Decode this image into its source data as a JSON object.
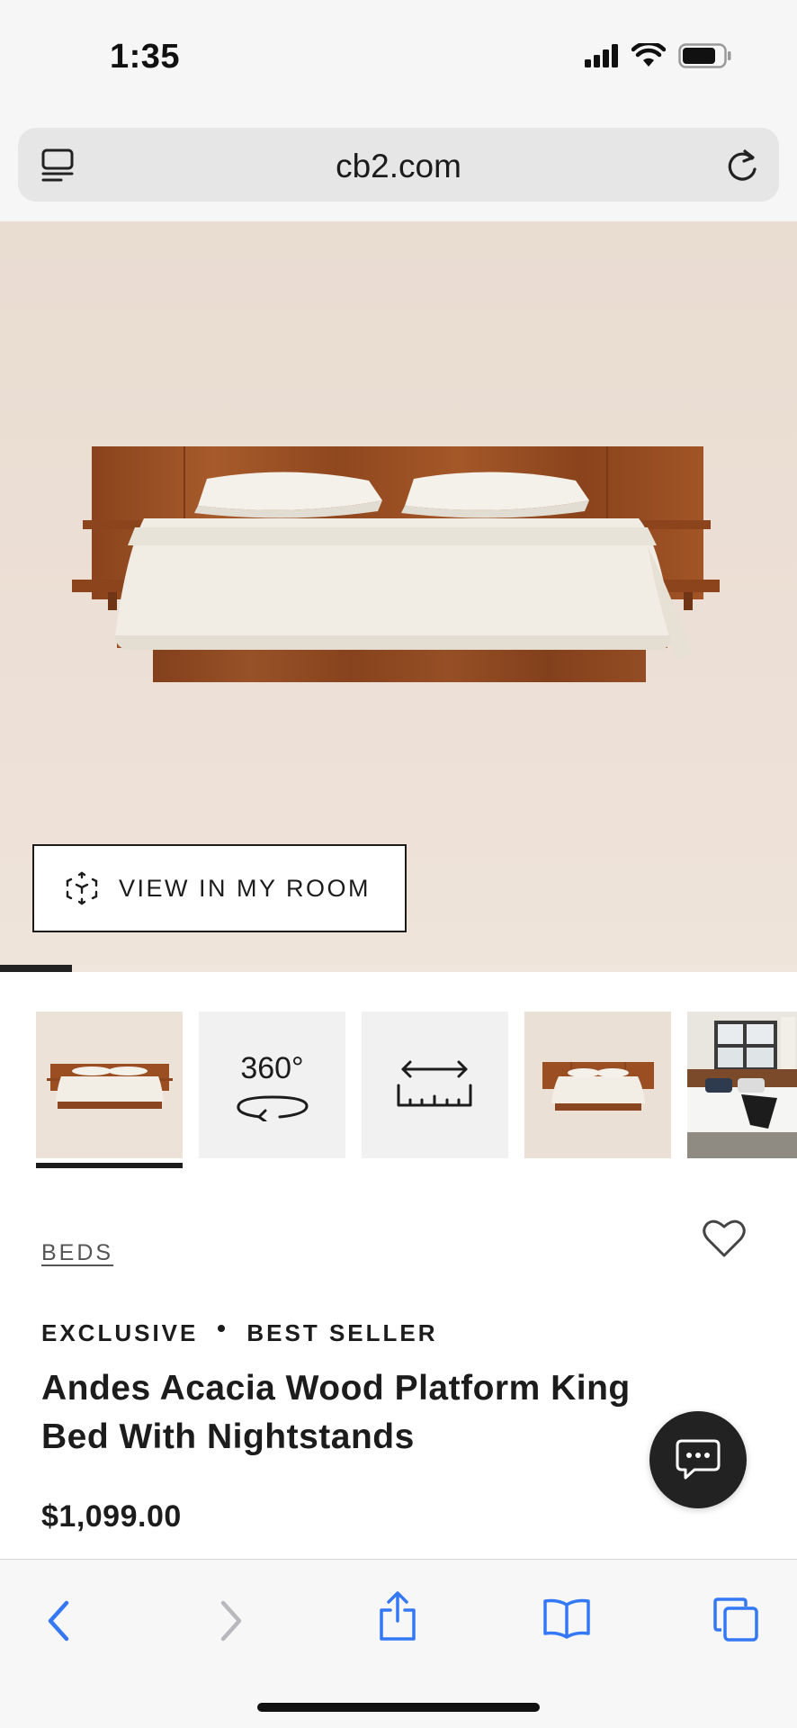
{
  "status_bar": {
    "time": "1:35",
    "icons": [
      "cellular-signal-icon",
      "wifi-icon",
      "battery-icon"
    ]
  },
  "browser": {
    "url": "cb2.com",
    "left_icon": "reader-mode-icon",
    "right_icon": "reload-icon"
  },
  "hero": {
    "image": "acacia-wood-platform-bed-photo",
    "view_in_room_label": "VIEW IN MY ROOM",
    "view_in_room_icon": "ar-cube-icon",
    "gallery_progress": 0.09
  },
  "thumbnails": [
    {
      "type": "image",
      "description": "bed-front"
    },
    {
      "type": "360",
      "label": "360°"
    },
    {
      "type": "dimensions",
      "icon": "ruler-icon"
    },
    {
      "type": "image",
      "description": "bed-front-2"
    },
    {
      "type": "image",
      "description": "bedroom-scene"
    }
  ],
  "product": {
    "category": "BEDS",
    "badges": [
      "EXCLUSIVE",
      "BEST SELLER"
    ],
    "title": "Andes Acacia Wood Platform King Bed With Nightstands",
    "price": "$1,099.00"
  },
  "toolbar": {
    "items": [
      "back-icon",
      "forward-icon",
      "share-icon",
      "bookmarks-icon",
      "tabs-icon"
    ]
  },
  "colors": {
    "accent_blue": "#3478f6",
    "text_dark": "#1c1c1c",
    "hero_bg": "#ecdfd5",
    "wood": "#9a4e22"
  }
}
